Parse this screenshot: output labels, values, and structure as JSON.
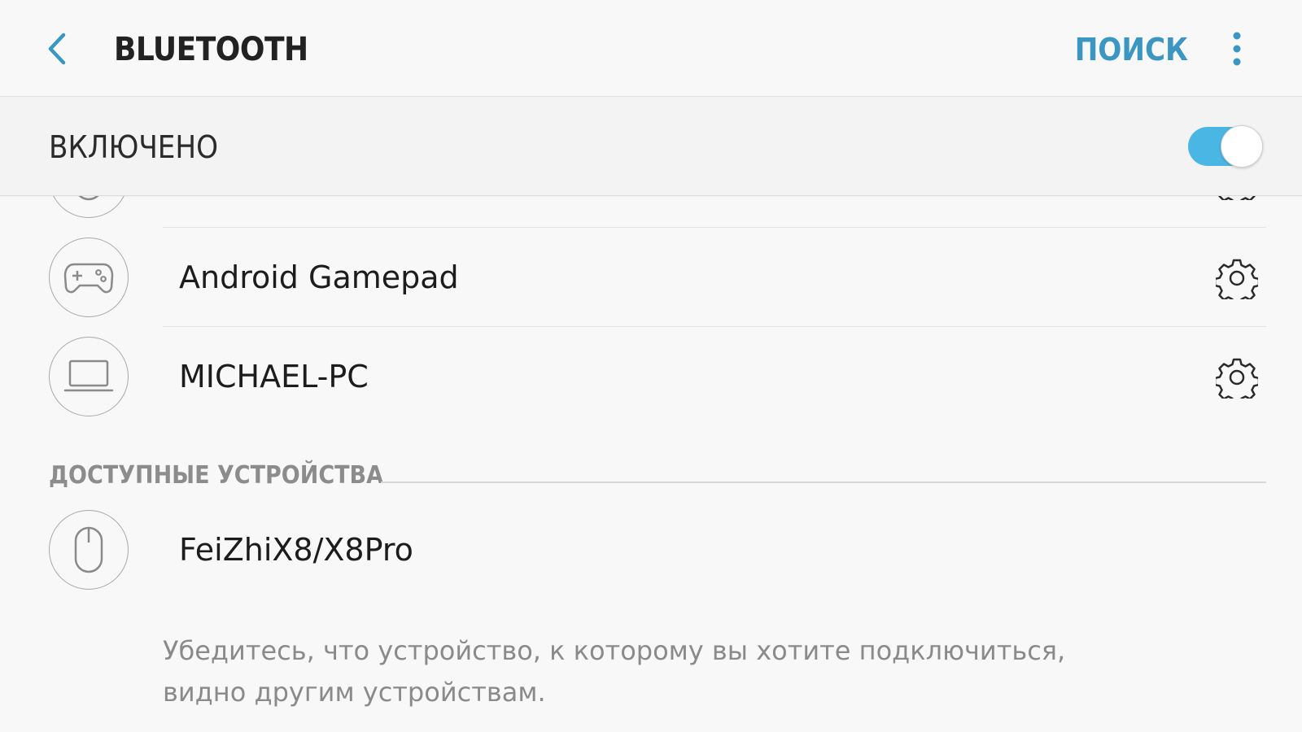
{
  "header": {
    "title": "BLUETOOTH",
    "search_label": "ПОИСК",
    "back_icon": "chevron-left-icon",
    "more_icon": "more-vertical-icon",
    "accent_color": "#3b96c1"
  },
  "master": {
    "label": "ВКЛЮЧЕНО",
    "enabled": true,
    "toggle_color": "#4ab6e3"
  },
  "paired_devices": [
    {
      "name": "",
      "icon": "mouse-icon",
      "partially_hidden": true
    },
    {
      "name": "Android Gamepad",
      "icon": "gamepad-icon",
      "settings_icon": "gear-icon"
    },
    {
      "name": "MICHAEL-PC",
      "icon": "laptop-icon",
      "settings_icon": "gear-icon"
    }
  ],
  "available_section": {
    "title": "ДОСТУПНЫЕ УСТРОЙСТВА",
    "devices": [
      {
        "name": "FeiZhiX8/X8Pro",
        "icon": "mouse-icon"
      }
    ]
  },
  "hint": "Убедитесь, что устройство, к которому вы хотите подключиться, видно другим устройствам."
}
